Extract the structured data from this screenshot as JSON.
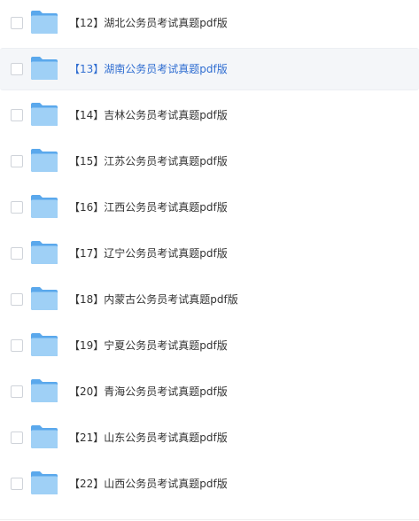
{
  "files": [
    {
      "name": "【12】湖北公务员考试真题pdf版",
      "icon": "folder-icon",
      "selected": false
    },
    {
      "name": "【13】湖南公务员考试真题pdf版",
      "icon": "folder-icon",
      "selected": true
    },
    {
      "name": "【14】吉林公务员考试真题pdf版",
      "icon": "folder-icon",
      "selected": false
    },
    {
      "name": "【15】江苏公务员考试真题pdf版",
      "icon": "folder-icon",
      "selected": false
    },
    {
      "name": "【16】江西公务员考试真题pdf版",
      "icon": "folder-icon",
      "selected": false
    },
    {
      "name": "【17】辽宁公务员考试真题pdf版",
      "icon": "folder-icon",
      "selected": false
    },
    {
      "name": "【18】内蒙古公务员考试真题pdf版",
      "icon": "folder-icon",
      "selected": false
    },
    {
      "name": "【19】宁夏公务员考试真题pdf版",
      "icon": "folder-icon",
      "selected": false
    },
    {
      "name": "【20】青海公务员考试真题pdf版",
      "icon": "folder-icon",
      "selected": false
    },
    {
      "name": "【21】山东公务员考试真题pdf版",
      "icon": "folder-icon",
      "selected": false
    },
    {
      "name": "【22】山西公务员考试真题pdf版",
      "icon": "folder-icon",
      "selected": false
    }
  ],
  "colors": {
    "selected_text": "#2f6dd1",
    "normal_text": "#333333",
    "folder_light": "#9fd0f6",
    "folder_dark": "#5aa8ec"
  }
}
